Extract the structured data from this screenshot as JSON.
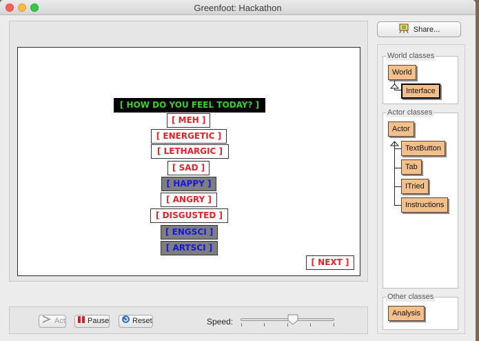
{
  "window": {
    "title": "Greenfoot: Hackathon"
  },
  "world": {
    "buttons": [
      {
        "id": "header",
        "label": "[ HOW DO YOU FEEL TODAY? ]",
        "style": "header"
      },
      {
        "id": "meh",
        "label": "[ MEH ]",
        "style": "normal"
      },
      {
        "id": "energetic",
        "label": "[ ENERGETIC ]",
        "style": "normal"
      },
      {
        "id": "lethargic",
        "label": "[ LETHARGIC ]",
        "style": "normal"
      },
      {
        "id": "sad",
        "label": "[ SAD ]",
        "style": "normal"
      },
      {
        "id": "happy",
        "label": "[ HAPPY ]",
        "style": "grey"
      },
      {
        "id": "angry",
        "label": "[ ANGRY ]",
        "style": "normal"
      },
      {
        "id": "disgusted",
        "label": "[ DISGUSTED ]",
        "style": "normal"
      },
      {
        "id": "engsci",
        "label": "[ ENGSCI ]",
        "style": "grey"
      },
      {
        "id": "artsci",
        "label": "[ ARTSCI ]",
        "style": "grey"
      },
      {
        "id": "next",
        "label": "[ NEXT ]",
        "style": "normal"
      }
    ]
  },
  "controls": {
    "act_label": "Act",
    "pause_label": "Pause",
    "reset_label": "Reset",
    "speed_label": "Speed:",
    "speed_value": 0.55
  },
  "sidebar": {
    "share_label": "Share...",
    "world_classes": {
      "title": "World classes",
      "items": [
        "World",
        "Interface"
      ]
    },
    "actor_classes": {
      "title": "Actor classes",
      "root": "Actor",
      "items": [
        "TextButton",
        "Tab",
        "ITried",
        "Instructions"
      ]
    },
    "other_classes": {
      "title": "Other classes",
      "items": [
        "Analysis"
      ]
    }
  },
  "colors": {
    "button_text": "#e5202a",
    "header_bg": "#000000",
    "header_text": "#39d12b",
    "selected_bg": "#7e7e7e",
    "selected_text": "#1616e6",
    "class_bg": "#f3c08c"
  }
}
